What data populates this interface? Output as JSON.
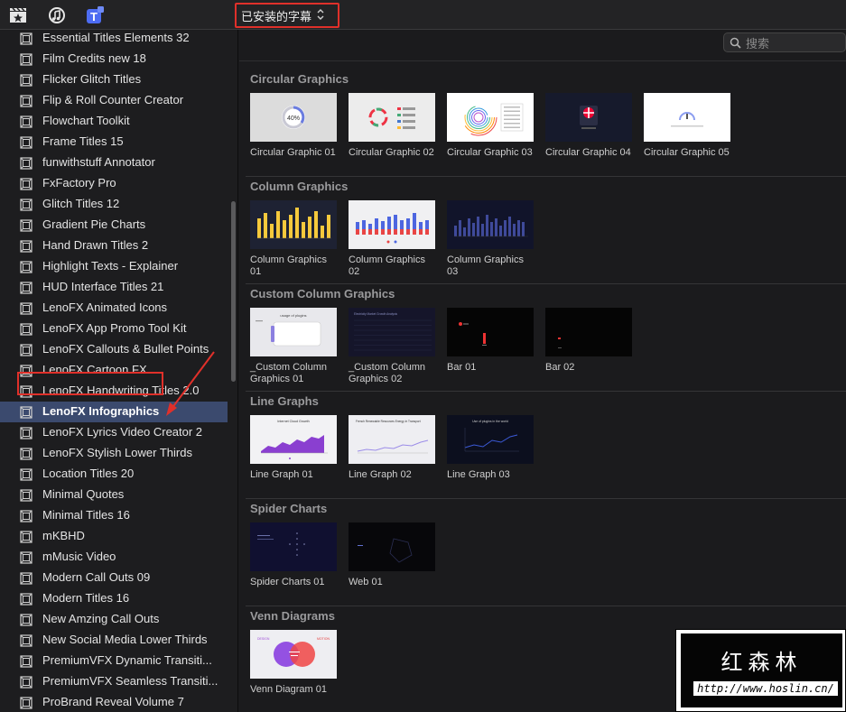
{
  "toolbar": {
    "icons": [
      "clapperboard-star-icon",
      "music-notes-icon",
      "titles-generators-icon"
    ],
    "dropdown_label": "已安装的字幕",
    "dropdown_chevron": "⌃⌄"
  },
  "search": {
    "placeholder": "搜索",
    "value": ""
  },
  "sidebar": {
    "items": [
      {
        "label": "Essential Titles Elements 32"
      },
      {
        "label": "Film Credits new 18"
      },
      {
        "label": "Flicker Glitch Titles"
      },
      {
        "label": "Flip & Roll Counter Creator"
      },
      {
        "label": "Flowchart Toolkit"
      },
      {
        "label": "Frame Titles 15"
      },
      {
        "label": "funwithstuff Annotator"
      },
      {
        "label": "FxFactory Pro"
      },
      {
        "label": "Glitch Titles 12"
      },
      {
        "label": "Gradient Pie Charts"
      },
      {
        "label": "Hand Drawn Titles 2"
      },
      {
        "label": "Highlight Texts - Explainer"
      },
      {
        "label": "HUD Interface Titles 21"
      },
      {
        "label": "LenoFX Animated Icons"
      },
      {
        "label": "LenoFX App Promo Tool Kit"
      },
      {
        "label": "LenoFX Callouts & Bullet Points"
      },
      {
        "label": "LenoFX Cartoon FX"
      },
      {
        "label": "LenoFX Handwriting Titles 2.0"
      },
      {
        "label": "LenoFX Infographics",
        "selected": true
      },
      {
        "label": "LenoFX Lyrics Video Creator 2"
      },
      {
        "label": "LenoFX Stylish Lower Thirds"
      },
      {
        "label": "Location Titles 20"
      },
      {
        "label": "Minimal Quotes"
      },
      {
        "label": "Minimal Titles 16"
      },
      {
        "label": "mKBHD"
      },
      {
        "label": "mMusic Video"
      },
      {
        "label": "Modern Call Outs 09"
      },
      {
        "label": "Modern Titles 16"
      },
      {
        "label": "New Amzing Call Outs"
      },
      {
        "label": "New Social Media Lower Thirds"
      },
      {
        "label": "PremiumVFX Dynamic Transiti..."
      },
      {
        "label": "PremiumVFX Seamless Transiti..."
      },
      {
        "label": "ProBrand Reveal Volume 7"
      }
    ]
  },
  "sections": [
    {
      "title": "Circular Graphics",
      "items": [
        {
          "label": "Circular Graphic 01",
          "thumb": "circ1"
        },
        {
          "label": "Circular Graphic 02",
          "thumb": "circ2"
        },
        {
          "label": "Circular Graphic 03",
          "thumb": "circ3"
        },
        {
          "label": "Circular Graphic 04",
          "thumb": "circ4"
        },
        {
          "label": "Circular Graphic 05",
          "thumb": "circ5"
        }
      ]
    },
    {
      "title": "Column Graphics",
      "items": [
        {
          "label": "Column Graphics 01",
          "thumb": "col1"
        },
        {
          "label": "Column Graphics 02",
          "thumb": "col2"
        },
        {
          "label": "Column Graphics 03",
          "thumb": "col3"
        }
      ]
    },
    {
      "title": "Custom Column Graphics",
      "items": [
        {
          "label": "_Custom Column Graphics 01",
          "thumb": "cc1"
        },
        {
          "label": "_Custom Column Graphics 02",
          "thumb": "cc2"
        },
        {
          "label": "Bar 01",
          "thumb": "bar1"
        },
        {
          "label": "Bar 02",
          "thumb": "bar2"
        }
      ]
    },
    {
      "title": "Line Graphs",
      "items": [
        {
          "label": "Line Graph 01",
          "thumb": "lg1"
        },
        {
          "label": "Line Graph 02",
          "thumb": "lg2"
        },
        {
          "label": "Line Graph 03",
          "thumb": "lg3"
        }
      ]
    },
    {
      "title": "Spider Charts",
      "items": [
        {
          "label": "Spider Charts 01",
          "thumb": "sp1"
        },
        {
          "label": "Web 01",
          "thumb": "web1"
        }
      ]
    },
    {
      "title": "Venn Diagrams",
      "items": [
        {
          "label": "Venn Diagram 01",
          "thumb": "venn1"
        }
      ]
    }
  ],
  "thumb_text": {
    "circ1": "40%",
    "cc1": "usage of plugins",
    "cc2": "Electricity Market Growth Analysis",
    "lg1": "Internet Cloud Growth",
    "lg2": "French Renewable Resources Energy in Transport",
    "lg3": "Use of plugins in the world",
    "venn_left": "DESIGN",
    "venn_right": "MOTION"
  },
  "watermark": {
    "title": "红森林",
    "url": "http://www.hoslin.cn/"
  },
  "colors": {
    "selection": "#3b4a6e",
    "highlight_box": "#e0302a",
    "background": "#1b1b1d"
  }
}
